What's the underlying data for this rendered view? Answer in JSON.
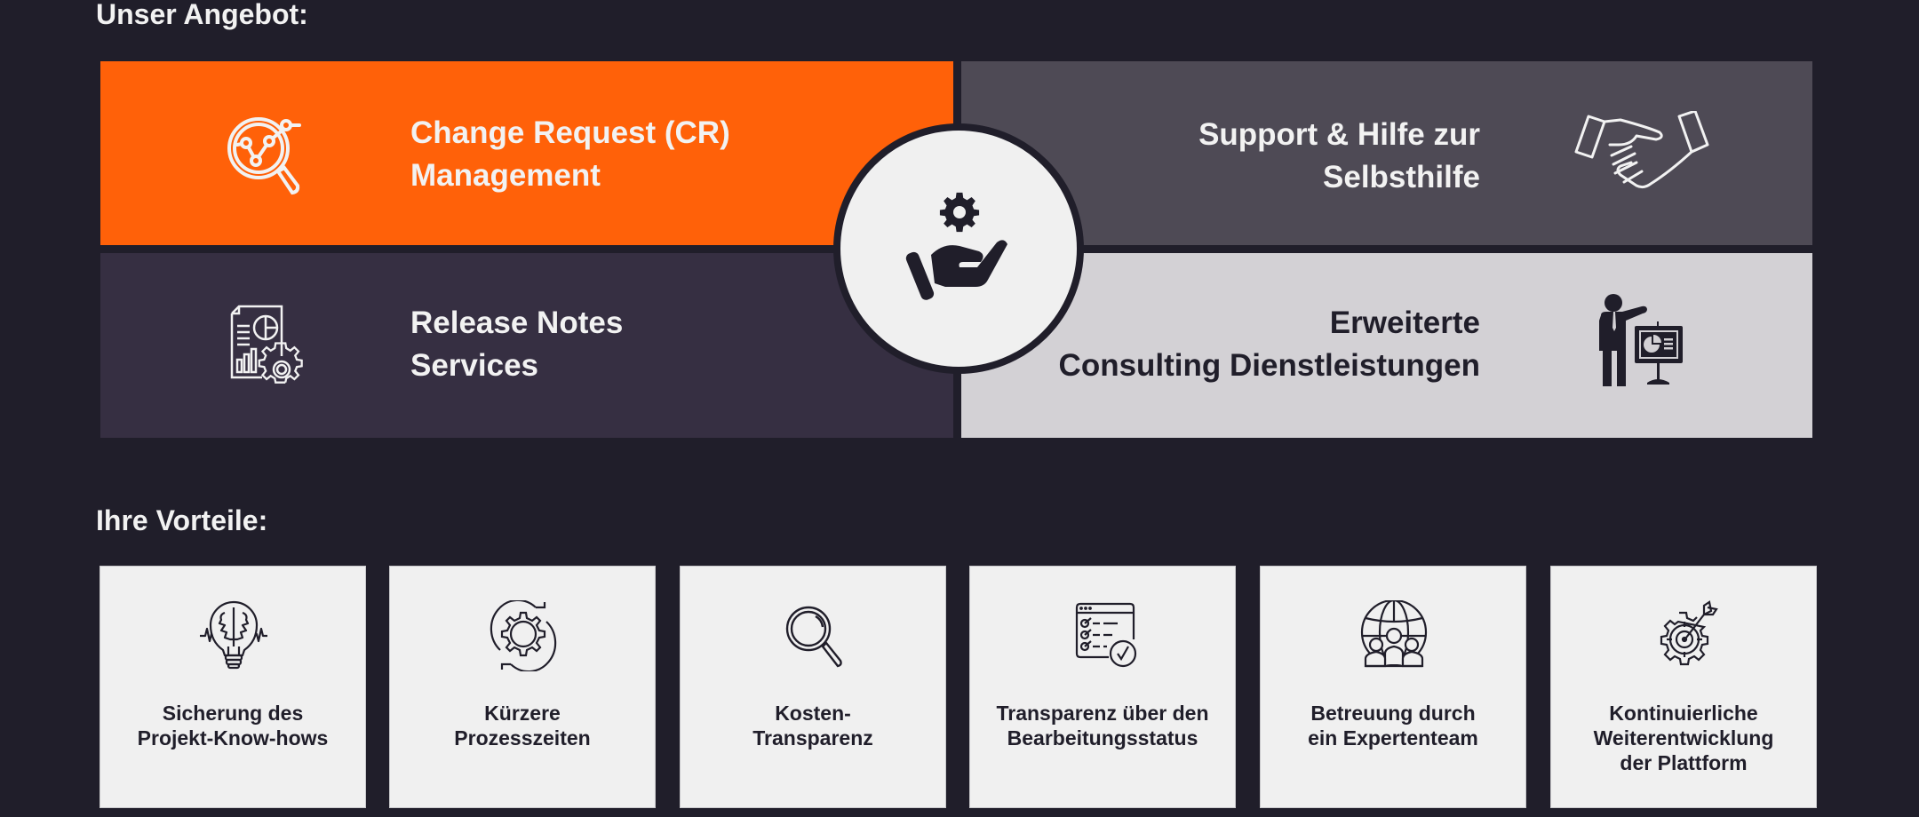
{
  "offer": {
    "title": "Unser Angebot:",
    "panels": [
      {
        "id": "cr",
        "lines": [
          "Change Request (CR)",
          "Management"
        ],
        "icon": "analytics-magnifier-icon",
        "color": "#ff6109"
      },
      {
        "id": "support",
        "lines": [
          "Support & Hilfe zur",
          "Selbsthilfe"
        ],
        "icon": "handshake-icon",
        "color": "#4e4a55"
      },
      {
        "id": "release",
        "lines": [
          "Release Notes",
          "Services"
        ],
        "icon": "report-gear-icon",
        "color": "#362f42"
      },
      {
        "id": "consult",
        "lines": [
          "Erweiterte",
          "Consulting Dienstleistungen"
        ],
        "icon": "presenter-icon",
        "color": "#d3d1d5"
      }
    ],
    "center_icon": "hand-gear-icon"
  },
  "benefits": {
    "title": "Ihre Vorteile:",
    "cards": [
      {
        "lines": [
          "Sicherung des",
          "Projekt-Know-hows"
        ],
        "icon": "brain-bulb-icon"
      },
      {
        "lines": [
          "Kürzere",
          "Prozesszeiten"
        ],
        "icon": "gear-cycle-icon"
      },
      {
        "lines": [
          "Kosten-",
          "Transparenz"
        ],
        "icon": "magnifier-icon"
      },
      {
        "lines": [
          "Transparenz über den",
          "Bearbeitungsstatus"
        ],
        "icon": "checklist-icon"
      },
      {
        "lines": [
          "Betreuung durch",
          "ein Expertenteam"
        ],
        "icon": "global-team-icon"
      },
      {
        "lines": [
          "Kontinuierliche",
          "Weiterentwicklung",
          "der Plattform"
        ],
        "icon": "gear-target-icon"
      }
    ]
  },
  "colors": {
    "background": "#201e2a",
    "accent": "#ff6109",
    "card": "#f0f0f0",
    "text_light": "#f2f2f2",
    "text_dark": "#201e2a"
  }
}
